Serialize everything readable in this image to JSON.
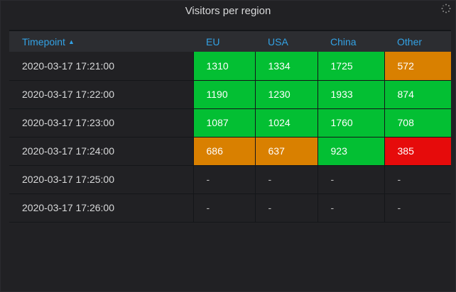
{
  "panel": {
    "title": "Visitors per region",
    "loading_icon": "spinner-icon"
  },
  "table": {
    "columns": [
      {
        "label": "Timepoint",
        "sorted": "ascending"
      },
      {
        "label": "EU"
      },
      {
        "label": "USA"
      },
      {
        "label": "China"
      },
      {
        "label": "Other"
      }
    ],
    "sort_icon": "caret-up-icon",
    "rows": [
      {
        "time": "2020-03-17 17:21:00",
        "values": [
          "1310",
          "1334",
          "1725",
          "572"
        ]
      },
      {
        "time": "2020-03-17 17:22:00",
        "values": [
          "1190",
          "1230",
          "1933",
          "874"
        ]
      },
      {
        "time": "2020-03-17 17:23:00",
        "values": [
          "1087",
          "1024",
          "1760",
          "708"
        ]
      },
      {
        "time": "2020-03-17 17:24:00",
        "values": [
          "686",
          "637",
          "923",
          "385"
        ]
      },
      {
        "time": "2020-03-17 17:25:00",
        "values": [
          "-",
          "-",
          "-",
          "-"
        ]
      },
      {
        "time": "2020-03-17 17:26:00",
        "values": [
          "-",
          "-",
          "-",
          "-"
        ]
      }
    ],
    "cell_colors": [
      [
        "green",
        "green",
        "green",
        "orange"
      ],
      [
        "green",
        "green",
        "green",
        "green"
      ],
      [
        "green",
        "green",
        "green",
        "green"
      ],
      [
        "orange",
        "orange",
        "green",
        "red"
      ],
      [
        "none",
        "none",
        "none",
        "none"
      ],
      [
        "none",
        "none",
        "none",
        "none"
      ]
    ]
  },
  "colors": {
    "green": "#03bf33",
    "orange": "#d98000",
    "red": "#e60b0b",
    "header_text": "#33a2e5",
    "panel_bg": "#212124"
  }
}
